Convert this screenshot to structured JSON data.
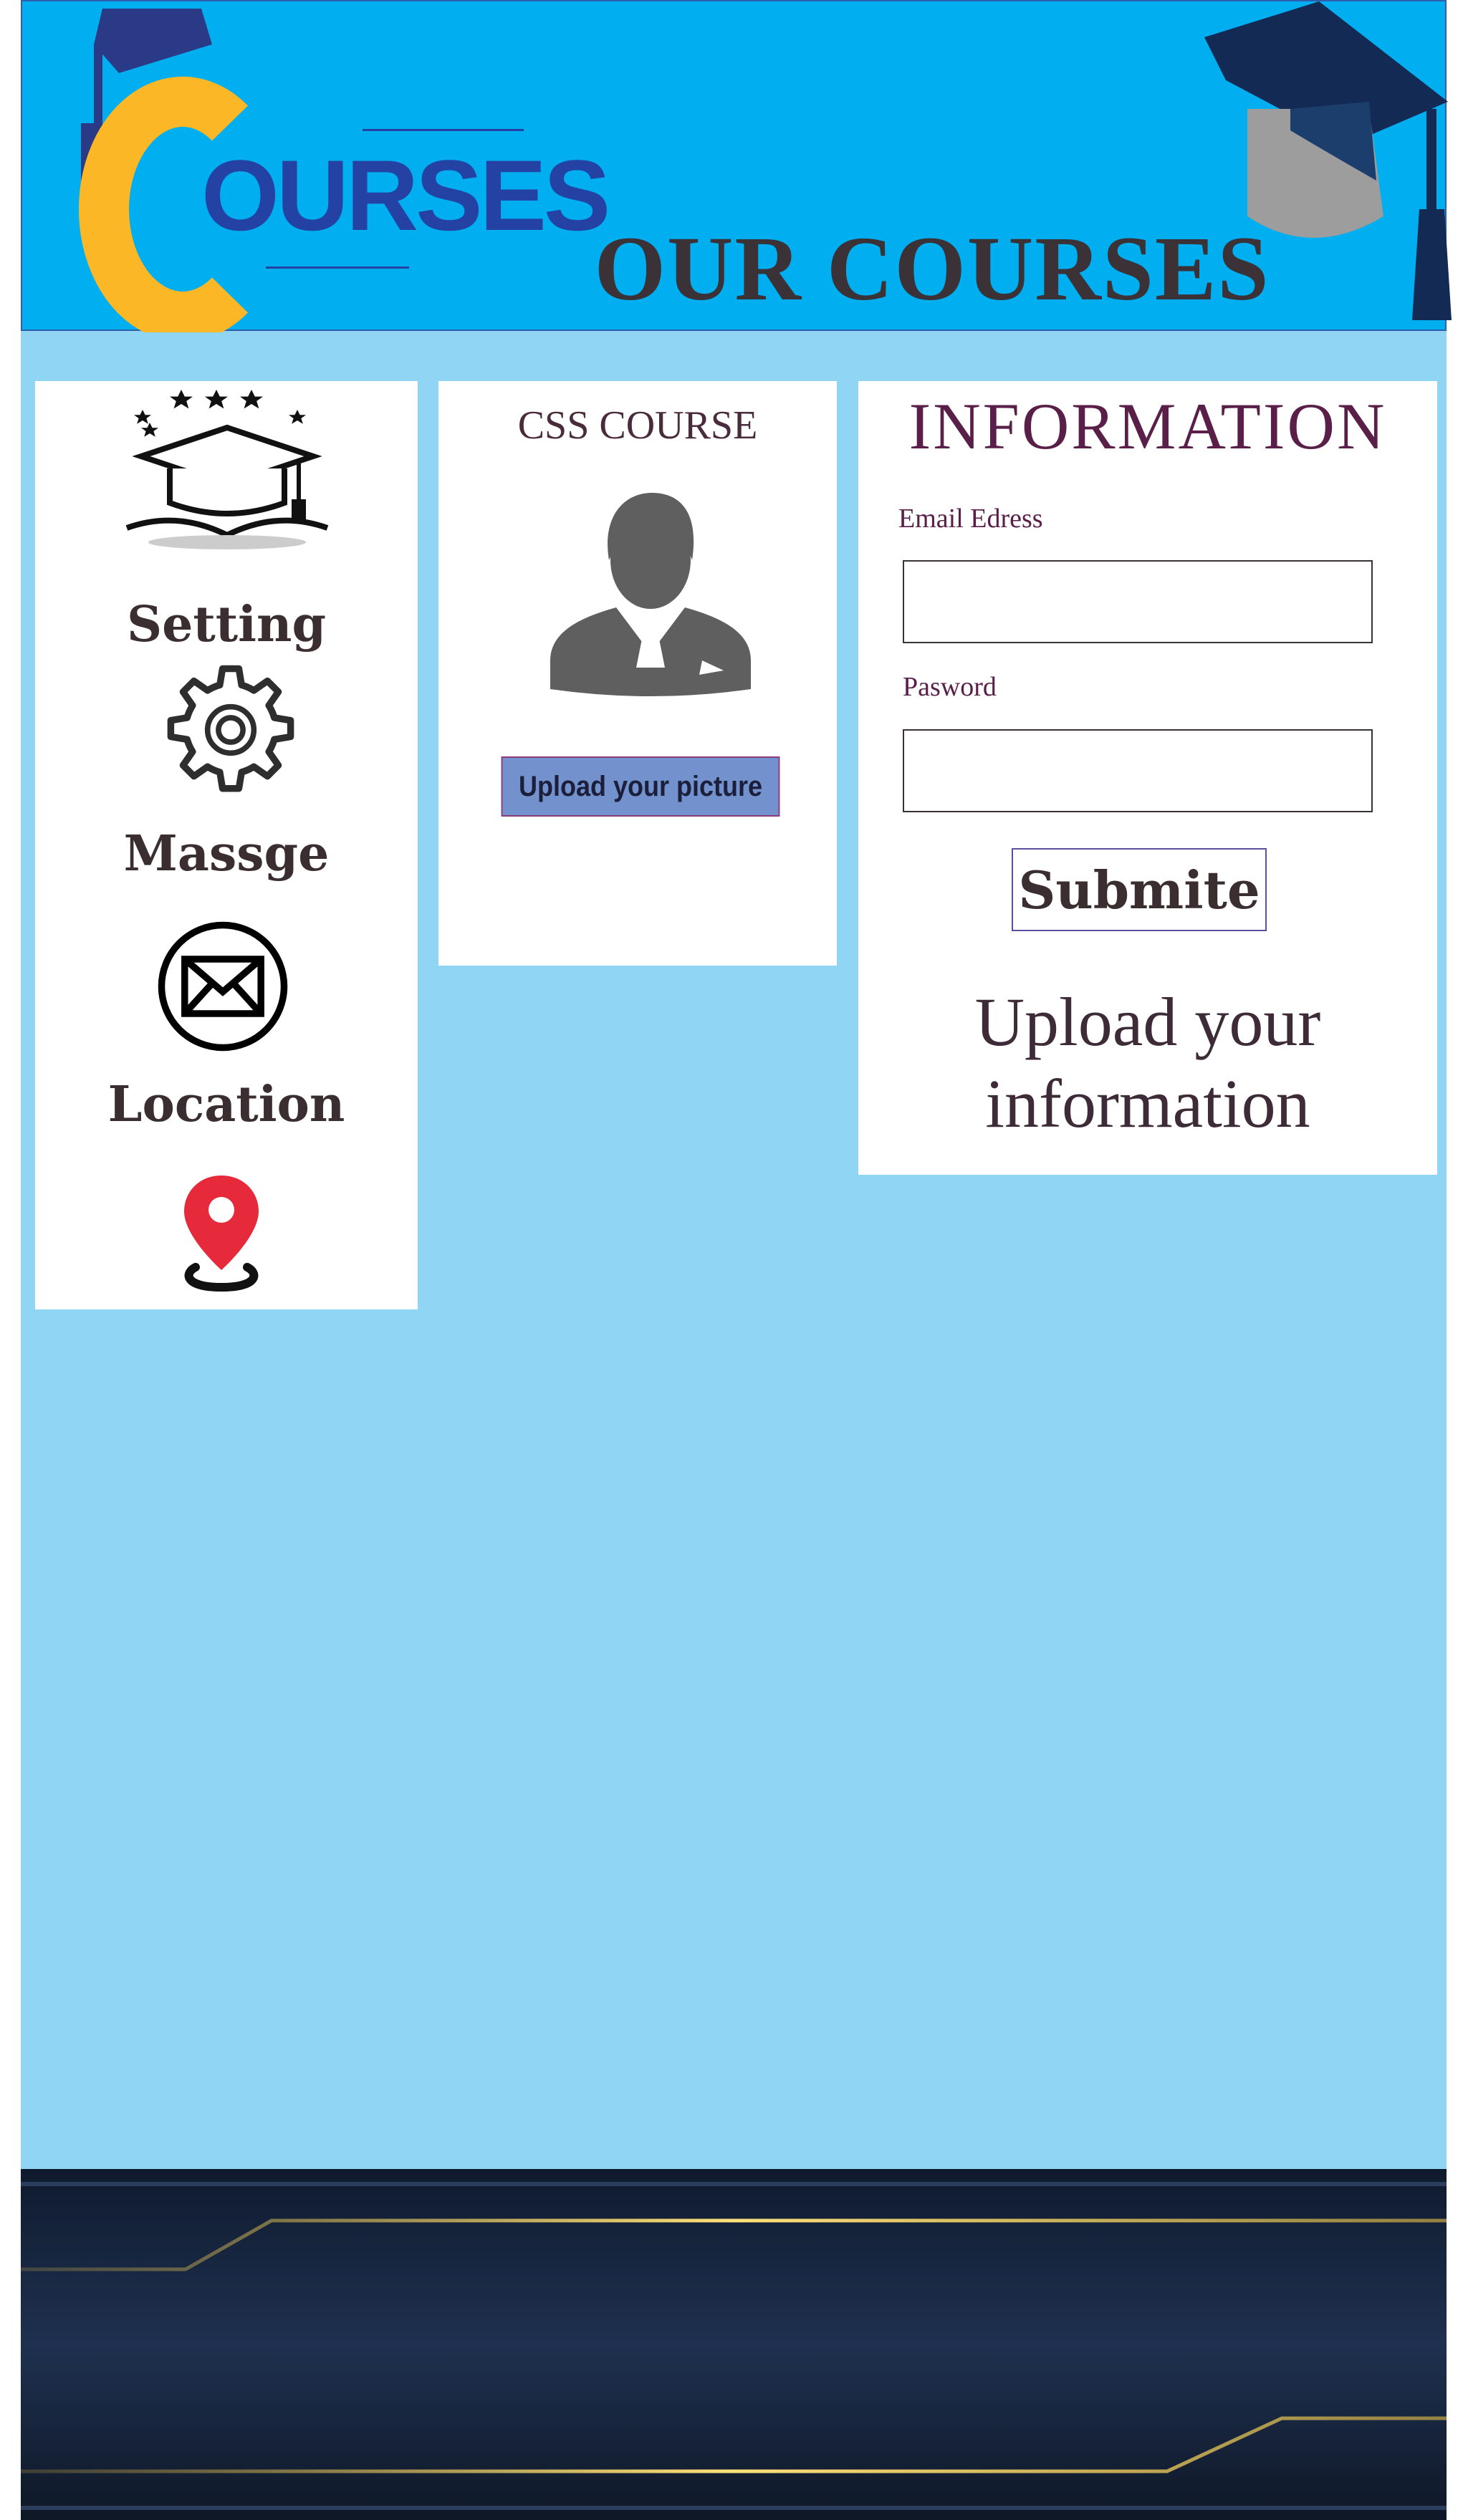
{
  "header": {
    "logo_text": "OURSES",
    "title": "OUR COURSES"
  },
  "sidebar": {
    "items": [
      {
        "label": "Setting",
        "icon": "gear-icon"
      },
      {
        "label": "Massge",
        "icon": "envelope-icon"
      },
      {
        "label": "Location",
        "icon": "location-pin-icon"
      }
    ],
    "top_icon": "graduation-cap-book-icon"
  },
  "course": {
    "title": "CSS COURSE",
    "avatar_icon": "user-avatar-icon",
    "upload_label": "Upload your picture"
  },
  "info": {
    "title": "INFORMATION",
    "email_label": "Email Edress",
    "email_value": "",
    "password_label": "Pasword",
    "password_value": "",
    "submit_label": "Submite",
    "upload_line1": "Upload your",
    "upload_line2": "information"
  },
  "colors": {
    "header_bg": "#01aeef",
    "page_bg": "#90d6f4",
    "logo_yellow": "#fbb726",
    "logo_blue": "#2342a4",
    "title_text": "#3a3236",
    "pin_red": "#e62a3c",
    "footer_dark": "#16233b",
    "footer_gold": "#e8c14a"
  }
}
